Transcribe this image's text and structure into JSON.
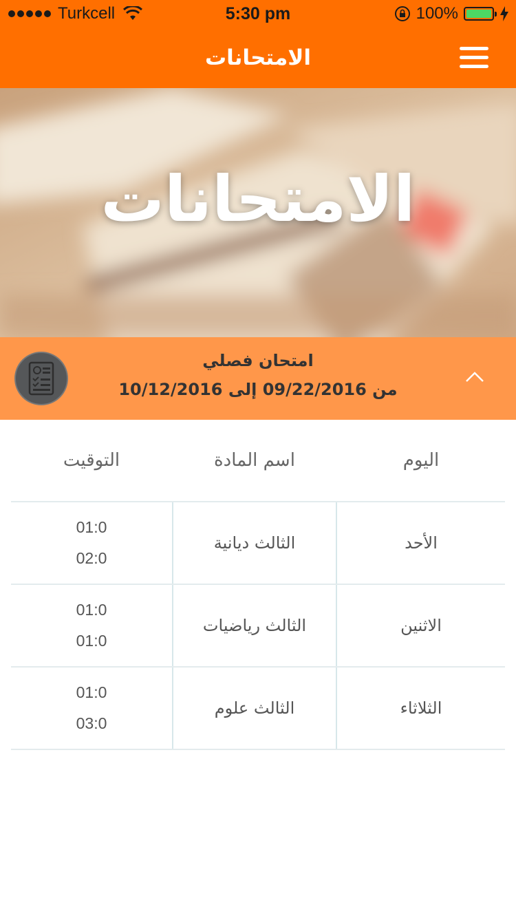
{
  "status_bar": {
    "carrier": "Turkcell",
    "time": "5:30 pm",
    "battery": "100%",
    "battery_level": 1.0,
    "signal_bars": 5
  },
  "nav": {
    "title": "الامتحانات"
  },
  "hero": {
    "title": "الامتحانات"
  },
  "exam": {
    "title": "امتحان فصلي",
    "range": "من 09/22/2016 إلى 10/12/2016"
  },
  "table": {
    "headers": {
      "day": "اليوم",
      "subject": "اسم المادة",
      "time": "التوقيت"
    },
    "rows": [
      {
        "day": "الأحد",
        "subject": "الثالث ديانية",
        "start": "01:0",
        "end": "02:0"
      },
      {
        "day": "الاثنين",
        "subject": "الثالث رياضيات",
        "start": "01:0",
        "end": "01:0"
      },
      {
        "day": "الثلاثاء",
        "subject": "الثالث علوم",
        "start": "01:0",
        "end": "03:0"
      }
    ]
  },
  "colors": {
    "primary": "#FF6F00",
    "exam_header": "#FF974A"
  },
  "icons": [
    "wifi-icon",
    "rotation-lock-icon",
    "battery-icon",
    "charging-bolt-icon",
    "menu-icon",
    "exam-checklist-icon",
    "chevron-up-icon"
  ]
}
